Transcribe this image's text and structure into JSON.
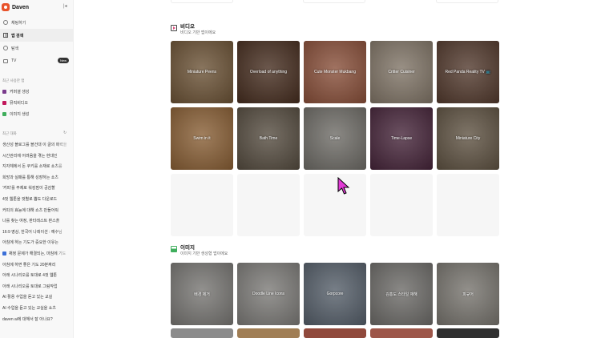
{
  "brand": {
    "name": "Daven",
    "collapse": "|◂"
  },
  "nav": [
    {
      "label": "채팅하기",
      "icon": "clock-icon",
      "active": false
    },
    {
      "label": "앱 검색",
      "icon": "grid-icon",
      "active": true
    },
    {
      "label": "탐색",
      "icon": "check-circle-icon",
      "active": false
    },
    {
      "label": "TV",
      "icon": "tv-icon",
      "active": false,
      "badge": "New"
    }
  ],
  "recent_apps": {
    "heading": "최근 사용한 앱",
    "items": [
      {
        "label": "커머셜 생성",
        "color": "#7a3b8c"
      },
      {
        "label": "뮤직비디오",
        "color": "#c2185b"
      },
      {
        "label": "이미지 생성",
        "color": "#3fae5c"
      }
    ]
  },
  "recent_chats": {
    "heading": "최근 대화",
    "items": [
      "생산성 블로그를 블건대 이 글의 매력을",
      "시간관리에 어려움을 겪는 현대인",
      "지자체에서 돈 쿠키를 소재로 쇼츠를",
      "희망과 실패를 통해 성장하는 쇼츠",
      "'커피'를 주제로 워킹맘이 공감할",
      "4컷 웹툰을 컷별로 뽑도 다운로드",
      "커피의 효능에 대해 쇼츠 만들어줘",
      "나를 찾는 여정, 판타레스트 판스플",
      "16:9 영상, 한국어 나레이션 : 예수님",
      "아침에 하는 기도가 중요한 이유는",
      "채정 문제가 해결되는, 마침에 기도",
      "아침에 하면 좋은 기도 20분짜리",
      "아래 시나리오를 토대로 4컷 웹툰",
      "아래 시나리오를 토대로 그림작업",
      "AI 활용 수업을 듣고 있는 교실",
      "AI 수업을 듣고 있는 교실을 쇼츠",
      "daven ai에 대해서 잘 아나요?"
    ]
  },
  "video": {
    "title": "비디오",
    "subtitle": "비디오 기반 앱이에요",
    "tiles": [
      {
        "label": "Miniature Peens",
        "bg": "#8a6a45"
      },
      {
        "label": "Overload of anything",
        "bg": "#5a3a28"
      },
      {
        "label": "Cute Monster Mukbang",
        "bg": "#b0664a"
      },
      {
        "label": "Critter Cuisiner",
        "bg": "#a59684"
      },
      {
        "label": "Red Panda Reality TV 📺",
        "bg": "#6a4a3a"
      },
      {
        "label": "Swim in it",
        "bg": "#b07a44"
      },
      {
        "label": "Bath Time",
        "bg": "#6e6252"
      },
      {
        "label": "Scale",
        "bg": "#8e8b84"
      },
      {
        "label": "Time-Lapse",
        "bg": "#5a2f4a"
      },
      {
        "label": "Miniature City",
        "bg": "#7a6a55"
      }
    ]
  },
  "image": {
    "title": "이미지",
    "subtitle": "이미지 기반 생성형 앱이에요",
    "tiles": [
      {
        "label": "배경 제거",
        "bg": "#9a9894"
      },
      {
        "label": "Doodle Line Icons",
        "bg": "#a09e9a"
      },
      {
        "label": "Gorpcore",
        "bg": "#6e7a88"
      },
      {
        "label": "김홍도 스타일 재해",
        "bg": "#8c8a86"
      },
      {
        "label": "피규어",
        "bg": "#9a968e"
      }
    ],
    "next_row_colors": [
      "#aaaaaa",
      "#c49a68",
      "#b05a4a",
      "#c06a5a",
      "#3a3a3a"
    ]
  }
}
